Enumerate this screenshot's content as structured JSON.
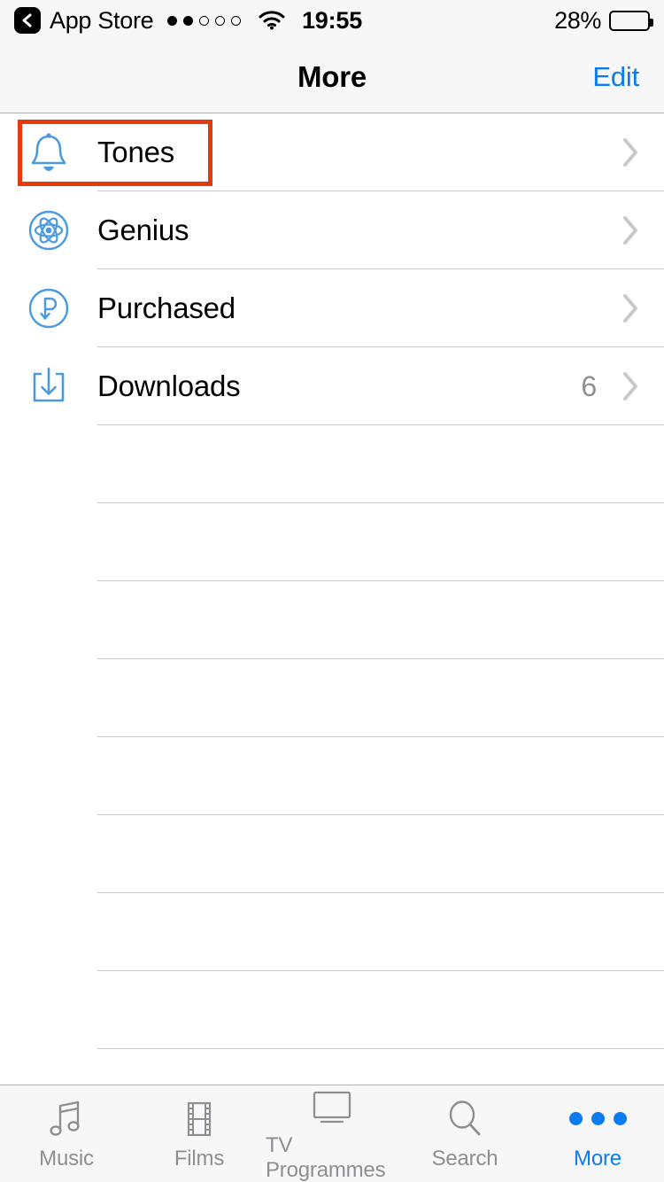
{
  "status_bar": {
    "back_label": "App Store",
    "back_icon": "chevron-left-icon",
    "signal_dots_filled": 2,
    "signal_dots_total": 5,
    "wifi_icon": "wifi-icon",
    "time": "19:55",
    "battery_percent_label": "28%",
    "battery_level": 28
  },
  "nav_bar": {
    "title": "More",
    "edit_label": "Edit"
  },
  "list": {
    "rows": [
      {
        "label": "Tones",
        "icon": "bell-icon",
        "badge": "",
        "chevron": "chevron-right-icon",
        "highlighted": true
      },
      {
        "label": "Genius",
        "icon": "atom-icon",
        "badge": "",
        "chevron": "chevron-right-icon",
        "highlighted": false
      },
      {
        "label": "Purchased",
        "icon": "purchased-icon",
        "badge": "",
        "chevron": "chevron-right-icon",
        "highlighted": false
      },
      {
        "label": "Downloads",
        "icon": "download-icon",
        "badge": "6",
        "chevron": "chevron-right-icon",
        "highlighted": false
      }
    ],
    "empty_row_count": 9
  },
  "tab_bar": {
    "tabs": [
      {
        "label": "Music",
        "icon": "music-note-icon",
        "active": false
      },
      {
        "label": "Films",
        "icon": "film-strip-icon",
        "active": false
      },
      {
        "label": "TV Programmes",
        "icon": "tv-icon",
        "active": false
      },
      {
        "label": "Search",
        "icon": "magnifier-icon",
        "active": false
      },
      {
        "label": "More",
        "icon": "ellipsis-icon",
        "active": true
      }
    ]
  },
  "colors": {
    "accent_blue": "#0a7cf0",
    "icon_blue": "#4a9ae0",
    "highlight_red": "#e8380d",
    "separator": "#c8c7cc",
    "inactive_gray": "#8e8e93",
    "bar_background": "#f7f7f7"
  }
}
